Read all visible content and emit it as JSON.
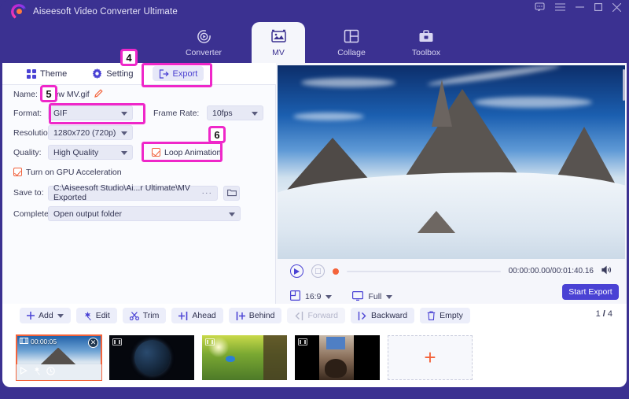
{
  "titlebar": {
    "app_title": "Aiseesoft Video Converter Ultimate",
    "logo_icon": "aiseesoft-logo-icon",
    "controls": [
      {
        "name": "feedback-icon",
        "glyph": "feedback"
      },
      {
        "name": "menu-icon",
        "glyph": "hamburger"
      },
      {
        "name": "minimize-icon",
        "glyph": "minimize"
      },
      {
        "name": "maximize-icon",
        "glyph": "maximize"
      },
      {
        "name": "close-icon",
        "glyph": "close"
      }
    ]
  },
  "nav": {
    "tabs": [
      {
        "label": "Converter",
        "icon": "converter-icon",
        "active": false
      },
      {
        "label": "MV",
        "icon": "mv-icon",
        "active": true
      },
      {
        "label": "Collage",
        "icon": "collage-icon",
        "active": false
      },
      {
        "label": "Toolbox",
        "icon": "toolbox-icon",
        "active": false
      }
    ]
  },
  "subtabs": [
    {
      "label": "Theme",
      "icon": "theme-icon",
      "active": false
    },
    {
      "label": "Setting",
      "icon": "setting-icon",
      "active": false
    },
    {
      "label": "Export",
      "icon": "export-icon",
      "active": true
    }
  ],
  "export_form": {
    "name_label": "Name:",
    "name_value": "New MV.gif",
    "name_edit_icon": "pencil-icon",
    "format_label": "Format:",
    "format_value": "GIF",
    "frame_rate_label": "Frame Rate:",
    "frame_rate_value": "10fps",
    "resolution_label": "Resolution:",
    "resolution_value": "1280x720 (720p)",
    "quality_label": "Quality:",
    "quality_value": "High Quality",
    "loop_animation_label": "Loop Animation",
    "loop_animation_checked": true,
    "gpu_label": "Turn on GPU Acceleration",
    "gpu_checked": true,
    "save_to_label": "Save to:",
    "save_to_value": "C:\\Aiseesoft Studio\\Ai...r Ultimate\\MV Exported",
    "browse_dots": "···",
    "folder_icon": "folder-icon",
    "complete_label": "Complete:",
    "complete_value": "Open output folder",
    "start_export_label": "Start Export"
  },
  "preview": {
    "play_icon": "play-icon",
    "stop_icon": "stop-icon",
    "timecode": "00:00:00.00/00:01:40.16",
    "volume_icon": "volume-icon",
    "aspect_icon": "aspect-ratio-icon",
    "aspect_value": "16:9",
    "screen_icon": "screen-icon",
    "screen_value": "Full",
    "start_export_label": "Start Export"
  },
  "edit_toolbar": {
    "buttons": [
      {
        "label": "Add",
        "icon": "plus-icon",
        "has_caret": true,
        "disabled": false
      },
      {
        "label": "Edit",
        "icon": "edit-wand-icon",
        "has_caret": false,
        "disabled": false
      },
      {
        "label": "Trim",
        "icon": "scissors-icon",
        "has_caret": false,
        "disabled": false
      },
      {
        "label": "Ahead",
        "icon": "insert-ahead-icon",
        "has_caret": false,
        "disabled": false
      },
      {
        "label": "Behind",
        "icon": "insert-behind-icon",
        "has_caret": false,
        "disabled": false
      },
      {
        "label": "Forward",
        "icon": "move-forward-icon",
        "has_caret": false,
        "disabled": true
      },
      {
        "label": "Backward",
        "icon": "move-backward-icon",
        "has_caret": false,
        "disabled": false
      },
      {
        "label": "Empty",
        "icon": "trash-icon",
        "has_caret": false,
        "disabled": false
      }
    ],
    "page_current": "1",
    "page_sep": "/",
    "page_total": "4"
  },
  "thumbnails": {
    "items": [
      {
        "name": "clip-snow-mountain",
        "duration": "00:00:05",
        "selected": true,
        "scene": "snow-mountain"
      },
      {
        "name": "clip-earth",
        "duration": "",
        "selected": false,
        "scene": "earth-space"
      },
      {
        "name": "clip-bird",
        "duration": "",
        "selected": false,
        "scene": "bird-meadow"
      },
      {
        "name": "clip-person",
        "duration": "",
        "selected": false,
        "scene": "person-indoor"
      }
    ],
    "add_label": "+",
    "close_glyph": "✕",
    "play_icon": "play-icon",
    "effect_icon": "magic-wand-icon",
    "clock_icon": "clock-icon"
  },
  "annotations": {
    "accent_color": "#ef27c9",
    "callouts": [
      {
        "number": "4",
        "target": "export-tab"
      },
      {
        "number": "5",
        "target": "format-select"
      },
      {
        "number": "6",
        "target": "loop-animation-checkbox"
      }
    ]
  }
}
